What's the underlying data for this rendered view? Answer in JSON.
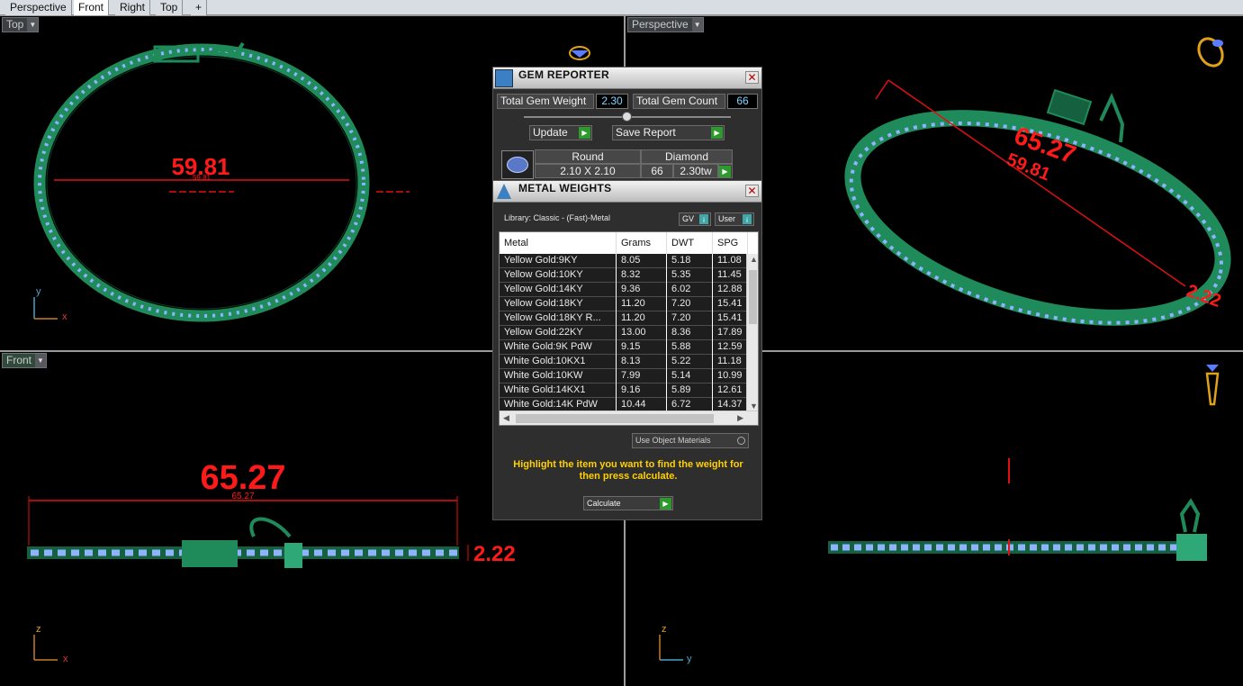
{
  "tabs": [
    "Perspective",
    "Front",
    "Right",
    "Top",
    "+"
  ],
  "active_tab": 1,
  "viewports": {
    "top": {
      "label": "Top",
      "dimension": "59.81",
      "dim_small": "59.81",
      "axis_a": "y",
      "axis_b": "x"
    },
    "perspective": {
      "label": "Perspective",
      "dim_a": "65.27",
      "dim_b": "59.81",
      "dim_c": "2.22"
    },
    "front": {
      "label": "Front",
      "dimension": "65.27",
      "dim_small": "65.27",
      "dim_side": "2.22",
      "axis_a": "z",
      "axis_b": "x"
    },
    "right": {
      "axis_a": "z",
      "axis_b": "y"
    }
  },
  "gem_reporter": {
    "title": "GEM REPORTER",
    "close": "✕",
    "total_weight_label": "Total Gem Weight",
    "total_weight_value": "2.30",
    "total_count_label": "Total Gem Count",
    "total_count_value": "66",
    "update_label": "Update",
    "save_label": "Save Report",
    "gem": {
      "shape": "Round",
      "material": "Diamond",
      "size": "2.10 X 2.10",
      "count": "66",
      "weight": "2.30tw"
    }
  },
  "metal_weights": {
    "title": "METAL WEIGHTS",
    "close": "✕",
    "library": "Library: Classic - (Fast)-Metal",
    "gv_label": "GV",
    "user_label": "User",
    "columns": [
      "Metal",
      "Grams",
      "DWT",
      "SPG"
    ],
    "rows": [
      [
        "Yellow Gold:9KY",
        "8.05",
        "5.18",
        "11.08"
      ],
      [
        "Yellow Gold:10KY",
        "8.32",
        "5.35",
        "11.45"
      ],
      [
        "Yellow Gold:14KY",
        "9.36",
        "6.02",
        "12.88"
      ],
      [
        "Yellow Gold:18KY",
        "11.20",
        "7.20",
        "15.41"
      ],
      [
        "Yellow Gold:18KY R...",
        "11.20",
        "7.20",
        "15.41"
      ],
      [
        "Yellow Gold:22KY",
        "13.00",
        "8.36",
        "17.89"
      ],
      [
        "White Gold:9K PdW",
        "9.15",
        "5.88",
        "12.59"
      ],
      [
        "White Gold:10KX1",
        "8.13",
        "5.22",
        "11.18"
      ],
      [
        "White Gold:10KW",
        "7.99",
        "5.14",
        "10.99"
      ],
      [
        "White Gold:14KX1",
        "9.16",
        "5.89",
        "12.61"
      ],
      [
        "White Gold:14K PdW",
        "10.44",
        "6.72",
        "14.37"
      ]
    ],
    "use_object_materials": "Use Object Materials",
    "instruction": "Highlight the item you want to find the weight for then press calculate.",
    "calculate_label": "Calculate"
  }
}
